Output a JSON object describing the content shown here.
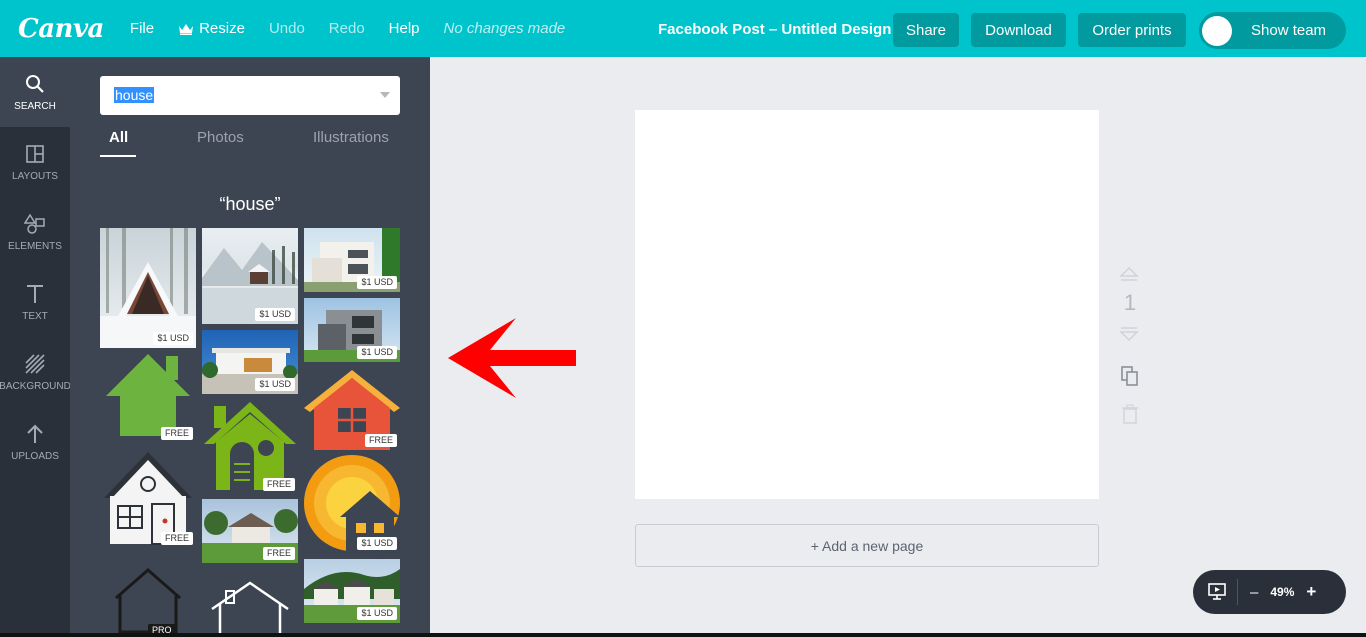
{
  "app": {
    "logo": "Canva"
  },
  "menu": {
    "file": "File",
    "resize": "Resize",
    "undo": "Undo",
    "redo": "Redo",
    "help": "Help",
    "status": "No changes made"
  },
  "header": {
    "doc_title": "Facebook Post – Untitled Design",
    "share": "Share",
    "download": "Download",
    "order_prints": "Order prints",
    "show_team": "Show team"
  },
  "rail": {
    "search": "Search",
    "layouts": "Layouts",
    "elements": "Elements",
    "text": "Text",
    "background": "Background",
    "uploads": "Uploads"
  },
  "search": {
    "query": "house",
    "tabs": {
      "all": "All",
      "photos": "Photos",
      "illustrations": "Illustrations"
    },
    "results_title": "“house”"
  },
  "results": [
    {
      "name": "snowy-a-frame-cabin",
      "badge": "$1 USD"
    },
    {
      "name": "snowy-mountain-cabin",
      "badge": "$1 USD"
    },
    {
      "name": "modern-white-house",
      "badge": "$1 USD"
    },
    {
      "name": "modern-grey-house",
      "badge": "$1 USD"
    },
    {
      "name": "white-villa-driveway",
      "badge": "$1 USD"
    },
    {
      "name": "green-house-icon",
      "badge": "FREE"
    },
    {
      "name": "green-birdhouse-icon",
      "badge": "FREE"
    },
    {
      "name": "red-house-icon",
      "badge": "FREE"
    },
    {
      "name": "white-house-drawing",
      "badge": "FREE"
    },
    {
      "name": "sunset-house-icon",
      "badge": "$1 USD"
    },
    {
      "name": "suburban-house-photo",
      "badge": "FREE"
    },
    {
      "name": "hillside-houses-photo",
      "badge": "$1 USD"
    },
    {
      "name": "house-outline-dark",
      "badge": "PRO"
    },
    {
      "name": "house-outline-white",
      "badge": ""
    }
  ],
  "canvas": {
    "page_number": "1",
    "add_page": "+ Add a new page",
    "zoom_minus": "–",
    "zoom_value": "49%",
    "zoom_plus": "+"
  },
  "colors": {
    "topbar": "#00c4cc",
    "button": "#009a9f",
    "rail": "#293039",
    "panel": "#3e4552",
    "arrow": "#ff0000"
  }
}
